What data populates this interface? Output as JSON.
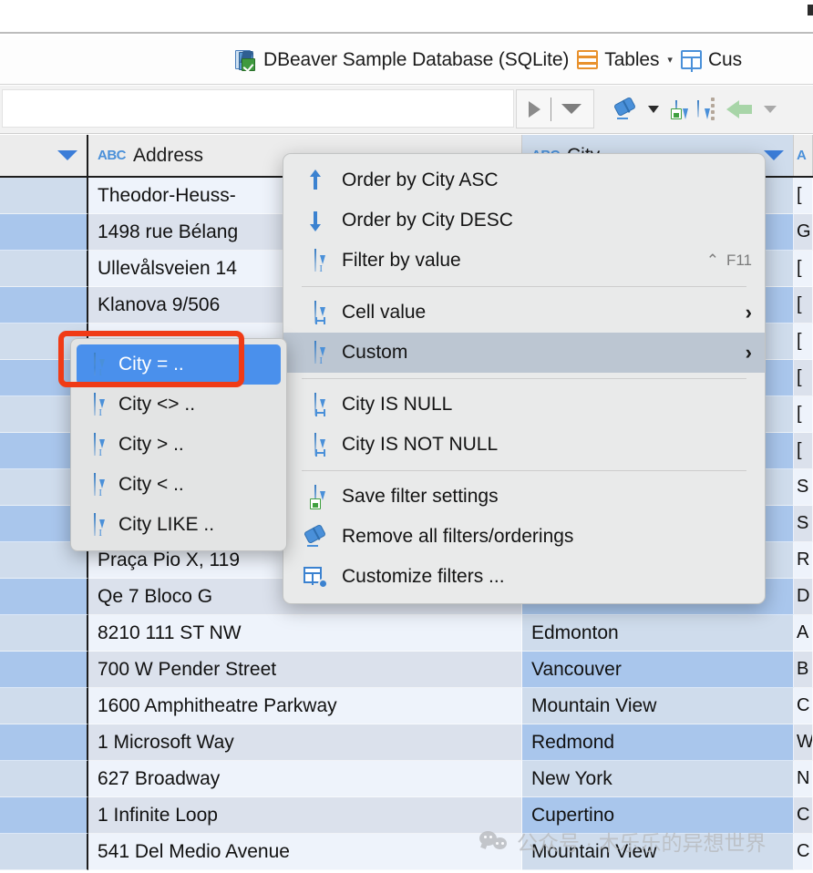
{
  "breadcrumb": {
    "database": "DBeaver Sample Database (SQLite)",
    "tables": "Tables",
    "tables_caret": "▾",
    "entity": "Cus"
  },
  "toolbar": {
    "filter_value": "",
    "filter_placeholder": "",
    "execute_label": "",
    "icons": [
      "play-icon",
      "dropdown-icon",
      "eraser-icon",
      "save-filter-icon",
      "filter-icon",
      "back-arrow-icon"
    ]
  },
  "grid": {
    "columns": [
      {
        "key": "rownum",
        "label": "",
        "type_icon": ""
      },
      {
        "key": "address",
        "label": "Address",
        "type_icon": "ABC"
      },
      {
        "key": "city",
        "label": "City",
        "type_icon": "ABC"
      },
      {
        "key": "state",
        "label": "A",
        "type_icon": ""
      }
    ],
    "rows": [
      {
        "num": "",
        "address": "Theodor-Heuss-",
        "city": "",
        "state": "["
      },
      {
        "num": "",
        "address": "1498 rue Bélang",
        "city": "",
        "state": "G"
      },
      {
        "num": "",
        "address": "Ullevålsveien 14",
        "city": "",
        "state": "["
      },
      {
        "num": "",
        "address": "Klanova 9/506",
        "city": "",
        "state": "["
      },
      {
        "num": "",
        "address": "",
        "city": "",
        "state": "["
      },
      {
        "num": "",
        "address": "",
        "city": "",
        "state": "["
      },
      {
        "num": "",
        "address": "",
        "city": "",
        "state": "["
      },
      {
        "num": "",
        "address": "",
        "city": "",
        "state": "["
      },
      {
        "num": "",
        "address": "",
        "city": "",
        "state": "S"
      },
      {
        "num": "",
        "address": "",
        "city": "",
        "state": "S"
      },
      {
        "num": "",
        "address": "Praça Pio X, 119",
        "city": "",
        "state": "R"
      },
      {
        "num": "",
        "address": "Qe 7 Bloco G",
        "city": "",
        "state": "D"
      },
      {
        "num": "",
        "address": "8210 111 ST NW",
        "city": "Edmonton",
        "state": "A"
      },
      {
        "num": "",
        "address": "700 W Pender Street",
        "city": "Vancouver",
        "state": "B"
      },
      {
        "num": "",
        "address": "1600 Amphitheatre Parkway",
        "city": "Mountain View",
        "state": "C"
      },
      {
        "num": "",
        "address": "1 Microsoft Way",
        "city": "Redmond",
        "state": "W"
      },
      {
        "num": "",
        "address": "627 Broadway",
        "city": "New York",
        "state": "N"
      },
      {
        "num": "",
        "address": "1 Infinite Loop",
        "city": "Cupertino",
        "state": "C"
      },
      {
        "num": "",
        "address": "541 Del Medio Avenue",
        "city": "Mountain View",
        "state": "C"
      }
    ]
  },
  "context_menu": {
    "items": [
      {
        "id": "order-asc",
        "label": "Order by City ASC",
        "icon": "arrow-up-icon",
        "shortcut": "",
        "submenu": false
      },
      {
        "id": "order-desc",
        "label": "Order by City DESC",
        "icon": "arrow-down-icon",
        "shortcut": "",
        "submenu": false
      },
      {
        "id": "filter-by-value",
        "label": "Filter by value",
        "icon": "filter-icon",
        "shortcut": "F11",
        "shortcut_modifier": "⌃",
        "submenu": false
      },
      {
        "id": "cell-value",
        "label": "Cell value",
        "icon": "filter-cell-icon",
        "shortcut": "",
        "submenu": true
      },
      {
        "id": "custom",
        "label": "Custom",
        "icon": "filter-custom-icon",
        "shortcut": "",
        "submenu": true,
        "highlighted": true
      },
      {
        "id": "is-null",
        "label": "City IS NULL",
        "icon": "filter-cell-icon",
        "shortcut": "",
        "submenu": false
      },
      {
        "id": "is-not-null",
        "label": "City IS NOT NULL",
        "icon": "filter-cell-icon",
        "shortcut": "",
        "submenu": false
      },
      {
        "id": "save-filter-settings",
        "label": "Save filter settings",
        "icon": "save-filter-icon",
        "shortcut": "",
        "submenu": false
      },
      {
        "id": "remove-all-filters",
        "label": "Remove all filters/orderings",
        "icon": "eraser-icon",
        "shortcut": "",
        "submenu": false
      },
      {
        "id": "customize-filters",
        "label": "Customize filters ...",
        "icon": "customize-filters-icon",
        "shortcut": "",
        "submenu": false
      }
    ]
  },
  "sub_menu": {
    "items": [
      {
        "id": "eq",
        "label": "City = ..",
        "selected": true
      },
      {
        "id": "neq",
        "label": "City <> ..",
        "selected": false
      },
      {
        "id": "gt",
        "label": "City > ..",
        "selected": false
      },
      {
        "id": "lt",
        "label": "City < ..",
        "selected": false
      },
      {
        "id": "like",
        "label": "City LIKE ..",
        "selected": false
      }
    ]
  },
  "annotation": {
    "color": "#f03b16",
    "target": "City = .."
  },
  "watermark": {
    "text": "公众号 · 木乐乐的异想世界"
  }
}
